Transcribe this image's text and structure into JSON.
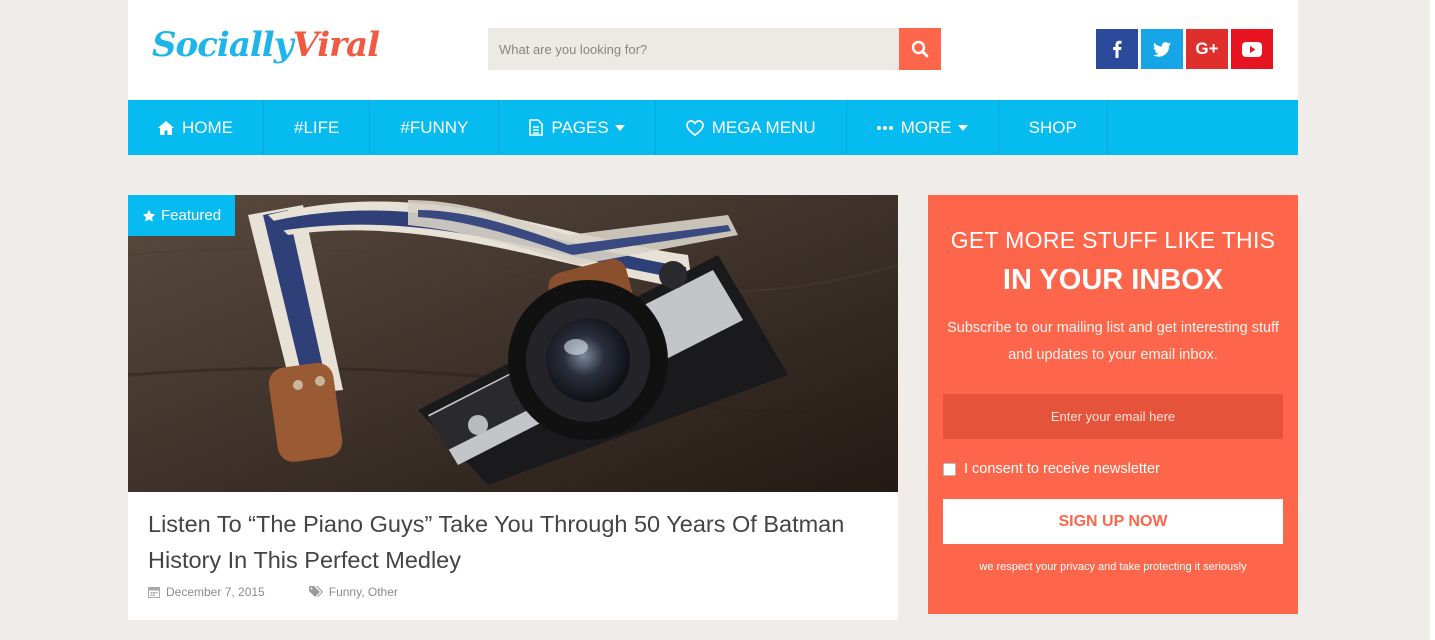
{
  "brand": {
    "part1": "Socially",
    "part2": "Viral",
    "color1": "#1fb5ea",
    "color2": "#f05a43"
  },
  "search": {
    "placeholder": "What are you looking for?",
    "button_icon": "search-icon"
  },
  "social": [
    {
      "name": "facebook",
      "icon": "facebook-icon",
      "color": "#2b4a9c"
    },
    {
      "name": "twitter",
      "icon": "twitter-icon",
      "color": "#16a6e7"
    },
    {
      "name": "google-plus",
      "icon": "google-plus-icon",
      "label": "G+",
      "color": "#e02e2c"
    },
    {
      "name": "youtube",
      "icon": "youtube-icon",
      "color": "#e71321"
    }
  ],
  "nav": {
    "color": "#06bbf0",
    "items": [
      {
        "label": "HOME",
        "icon": "home-icon"
      },
      {
        "label": "#LIFE"
      },
      {
        "label": "#FUNNY"
      },
      {
        "label": "PAGES",
        "icon": "document-icon",
        "dropdown": true
      },
      {
        "label": "MEGA MENU",
        "icon": "heart-icon"
      },
      {
        "label": "MORE",
        "icon": "ellipsis-icon",
        "dropdown": true
      },
      {
        "label": "SHOP"
      }
    ]
  },
  "featured": {
    "badge": "Featured",
    "badge_icon": "star-icon",
    "title": "Listen To “The Piano Guys” Take You Through 50 Years Of Batman History In This Perfect Medley",
    "date": "December 7, 2015",
    "categories": [
      "Funny",
      "Other"
    ],
    "separator": ", "
  },
  "newsletter": {
    "color": "#fe664c",
    "heading": "GET MORE STUFF LIKE THIS",
    "subheading": "IN YOUR INBOX",
    "description": "Subscribe to our mailing list and get interesting stuff and updates to your email inbox.",
    "email_placeholder": "Enter your email here",
    "consent": "I consent to receive newsletter",
    "button": "SIGN UP NOW",
    "privacy": "we respect your privacy and take protecting it seriously"
  }
}
